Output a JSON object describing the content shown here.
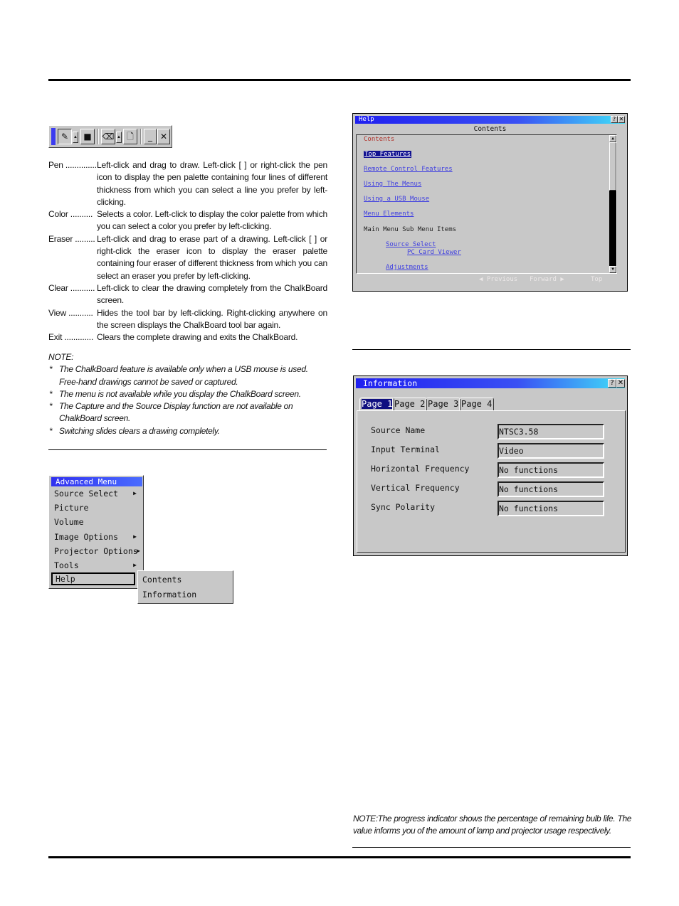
{
  "toolbar": {
    "buttons": [
      {
        "name": "pen",
        "icon": "pen-icon",
        "glyph": "✎"
      },
      {
        "name": "pen-palette",
        "icon": "triangle-up-icon",
        "glyph": "▲"
      },
      {
        "name": "color",
        "icon": "color-square-icon",
        "glyph": "■"
      },
      {
        "name": "eraser",
        "icon": "eraser-icon",
        "glyph": "⌫"
      },
      {
        "name": "eraser-palette",
        "icon": "triangle-up-icon",
        "glyph": "▲"
      },
      {
        "name": "clear",
        "icon": "clear-icon",
        "glyph": "🗋"
      },
      {
        "name": "view",
        "icon": "minimize-icon",
        "glyph": "_"
      },
      {
        "name": "exit",
        "icon": "close-icon",
        "glyph": "✕"
      }
    ]
  },
  "definitions": [
    {
      "term": "Pen ..............",
      "desc": "Left-click and drag to draw. Left-click [      ] or right-click the pen icon to display the pen palette containing four lines of different thickness from which you can select a line you prefer by left-clicking."
    },
    {
      "term": "Color ..........",
      "desc": "Selects a color. Left-click to display the color palette from which you can select a color you prefer by left-clicking."
    },
    {
      "term": "Eraser .........",
      "desc": "Left-click and drag to erase part of a drawing. Left-click [      ] or right-click the eraser icon to display the eraser palette containing four eraser of different thickness from which you can select an eraser you prefer by left-clicking."
    },
    {
      "term": "Clear ...........",
      "desc": "Left-click to clear the drawing completely from the ChalkBoard screen."
    },
    {
      "term": "View ...........",
      "desc": "Hides the tool bar by left-clicking. Right-clicking anywhere on the screen displays the ChalkBoard tool bar again."
    },
    {
      "term": "Exit .............",
      "desc": "Clears the complete drawing and exits the ChalkBoard."
    }
  ],
  "note": {
    "heading": "NOTE:",
    "items": [
      "The ChalkBoard feature is available only when a USB mouse is used. Free-hand drawings cannot be saved or captured.",
      "The menu is not available while you display the ChalkBoard screen.",
      "The Capture and the Source Display function are not available on ChalkBoard screen.",
      "Switching slides clears a drawing completely."
    ]
  },
  "advanced_menu": {
    "title": "Advanced Menu",
    "items": [
      {
        "label": "Source Select",
        "has_submenu": true
      },
      {
        "label": "Picture",
        "has_submenu": false
      },
      {
        "label": "Volume",
        "has_submenu": false
      },
      {
        "label": "Image Options",
        "has_submenu": true
      },
      {
        "label": "Projector Options",
        "has_submenu": true
      },
      {
        "label": "Tools",
        "has_submenu": true
      },
      {
        "label": "Help",
        "has_submenu": true,
        "selected": true
      }
    ],
    "submenu": [
      "Contents",
      "Information"
    ],
    "arrow_glyph": "▶"
  },
  "help_window": {
    "title": "Help",
    "help_btn": "?",
    "close_btn": "✕",
    "heading": "Contents",
    "lines": [
      {
        "text": "Contents",
        "style": "red"
      },
      {
        "text": "Top Features",
        "style": "active-link"
      },
      {
        "text": "Remote Control Features",
        "style": "link"
      },
      {
        "text": "Using The Menus",
        "style": "link"
      },
      {
        "text": "Using a USB Mouse",
        "style": "link"
      },
      {
        "text": "Menu Elements",
        "style": "link"
      },
      {
        "text": "Main Menu Sub Menu Items",
        "style": "plain"
      },
      {
        "text": "Source Select",
        "style": "link"
      },
      {
        "text": "PC Card Viewer",
        "style": "link"
      },
      {
        "text": "Adjustments",
        "style": "link"
      }
    ],
    "scroll_up": "▲",
    "scroll_down": "▼",
    "nav": {
      "previous": "◀ Previous",
      "forward": "Forward ▶",
      "top": "Top"
    }
  },
  "info_window": {
    "title": "Information",
    "help_btn": "?",
    "close_btn": "✕",
    "tabs": [
      "Page 1",
      "Page 2",
      "Page 3",
      "Page 4"
    ],
    "active_tab": 0,
    "fields": [
      {
        "label": "Source Name",
        "value": "NTSC3.58"
      },
      {
        "label": "Input Terminal",
        "value": "Video"
      },
      {
        "label": "Horizontal Frequency",
        "value": "No functions"
      },
      {
        "label": "Vertical Frequency",
        "value": "No functions"
      },
      {
        "label": "Sync Polarity",
        "value": "No functions"
      }
    ]
  },
  "bottom_note": "NOTE:The progress indicator shows the percentage of remaining bulb life. The value informs you of the amount of lamp and projector usage respectively."
}
